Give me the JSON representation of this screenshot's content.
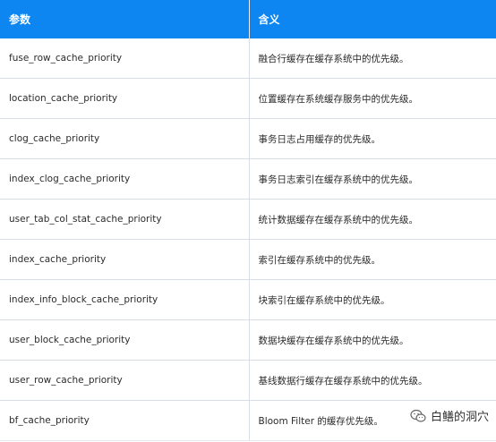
{
  "table": {
    "headers": [
      "参数",
      "含义"
    ],
    "rows": [
      [
        "fuse_row_cache_priority",
        "融合行缓存在缓存系统中的优先级。"
      ],
      [
        "location_cache_priority",
        "位置缓存在系统缓存服务中的优先级。"
      ],
      [
        "clog_cache_priority",
        "事务日志占用缓存的优先级。"
      ],
      [
        "index_clog_cache_priority",
        "事务日志索引在缓存系统中的优先级。"
      ],
      [
        "user_tab_col_stat_cache_priority",
        "统计数据缓存在缓存系统中的优先级。"
      ],
      [
        "index_cache_priority",
        "索引在缓存系统中的优先级。"
      ],
      [
        "index_info_block_cache_priority",
        "块索引在缓存系统中的优先级。"
      ],
      [
        "user_block_cache_priority",
        "数据块缓存在缓存系统中的优先级。"
      ],
      [
        "user_row_cache_priority",
        "基线数据行缓存在缓存系统中的优先级。"
      ],
      [
        "bf_cache_priority",
        "Bloom Filter 的缓存优先级。"
      ]
    ]
  },
  "watermark": {
    "text": "白鳝的洞穴",
    "icon": "wechat-icon"
  }
}
